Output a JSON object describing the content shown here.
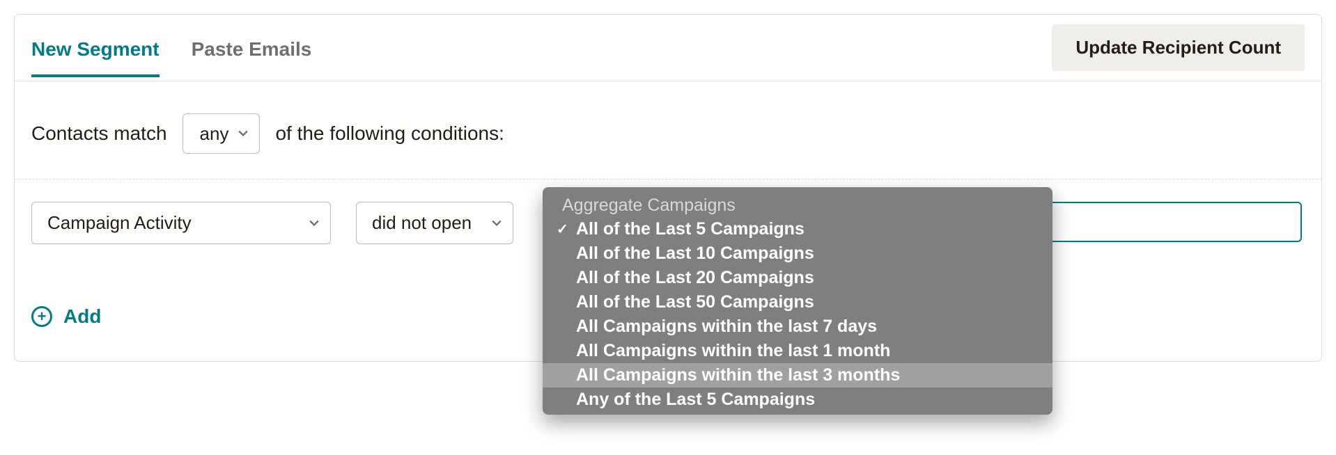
{
  "tabs": {
    "new_segment": "New Segment",
    "paste_emails": "Paste Emails"
  },
  "update_button": "Update Recipient Count",
  "match": {
    "prefix": "Contacts match",
    "selector_value": "any",
    "suffix": "of the following conditions:"
  },
  "condition": {
    "field_value": "Campaign Activity",
    "operator_value": "did not open"
  },
  "add_label": "Add",
  "dropdown": {
    "group_label": "Aggregate Campaigns",
    "options": [
      {
        "label": "All of the Last 5 Campaigns",
        "selected": true,
        "hover": false
      },
      {
        "label": "All of the Last 10 Campaigns",
        "selected": false,
        "hover": false
      },
      {
        "label": "All of the Last 20 Campaigns",
        "selected": false,
        "hover": false
      },
      {
        "label": "All of the Last 50 Campaigns",
        "selected": false,
        "hover": false
      },
      {
        "label": "All Campaigns within the last 7 days",
        "selected": false,
        "hover": false
      },
      {
        "label": "All Campaigns within the last 1 month",
        "selected": false,
        "hover": false
      },
      {
        "label": "All Campaigns within the last 3 months",
        "selected": false,
        "hover": true
      },
      {
        "label": "Any of the Last 5 Campaigns",
        "selected": false,
        "hover": false
      }
    ]
  }
}
